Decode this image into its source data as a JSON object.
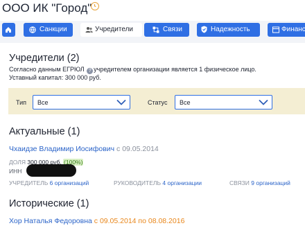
{
  "header": {
    "company_name": "ООО ИК \"Город\"",
    "history_icon": "clock-history-icon"
  },
  "tabs": [
    {
      "label": "",
      "icon": "home-icon",
      "active": false
    },
    {
      "label": "Санкции",
      "icon": "globe-icon",
      "active": false
    },
    {
      "label": "Учредители",
      "icon": "people-icon",
      "active": true
    },
    {
      "label": "Связи",
      "icon": "links-icon",
      "active": false
    },
    {
      "label": "Надежность",
      "icon": "shield-icon",
      "active": false
    },
    {
      "label": "Финанс",
      "icon": "finance-icon",
      "active": false
    }
  ],
  "founders": {
    "title": "Учредители (2)",
    "desc_part1": "Согласно данным ЕГРЮЛ",
    "desc_part2": "учредителем организации является 1 физическое лицо.",
    "capital": "Уставный капитал: 300 000 руб."
  },
  "filters": {
    "type_label": "Тип",
    "type_value": "Все",
    "status_label": "Статус",
    "status_value": "Все"
  },
  "current": {
    "title": "Актуальные (1)",
    "person_name": "Чхаидзе Владимир Иосифович",
    "person_since": "с 09.05.2014",
    "share_label": "ДОЛЯ",
    "share_value": "300 000 руб.",
    "share_percent": "(100%)",
    "inn_label": "ИНН",
    "founder_label": "УЧРЕДИТЕЛЬ",
    "founder_count": "6 организаций",
    "head_label": "РУКОВОДИТЕЛЬ",
    "head_count": "4 организации",
    "links_label": "СВЯЗИ",
    "links_count": "9 организаций"
  },
  "historical": {
    "title": "Исторические (1)",
    "person_name": "Хор Наталья Федоровна",
    "person_period": "с 09.05.2014 по 08.08.2016"
  },
  "colors": {
    "accent": "#2f6fe4",
    "tab_bar_bg": "#f2f4f8",
    "filter_bg": "#f4eed3",
    "link": "#2a63c8",
    "orange": "#e8861a",
    "badge_bg": "#d9f0c4"
  }
}
